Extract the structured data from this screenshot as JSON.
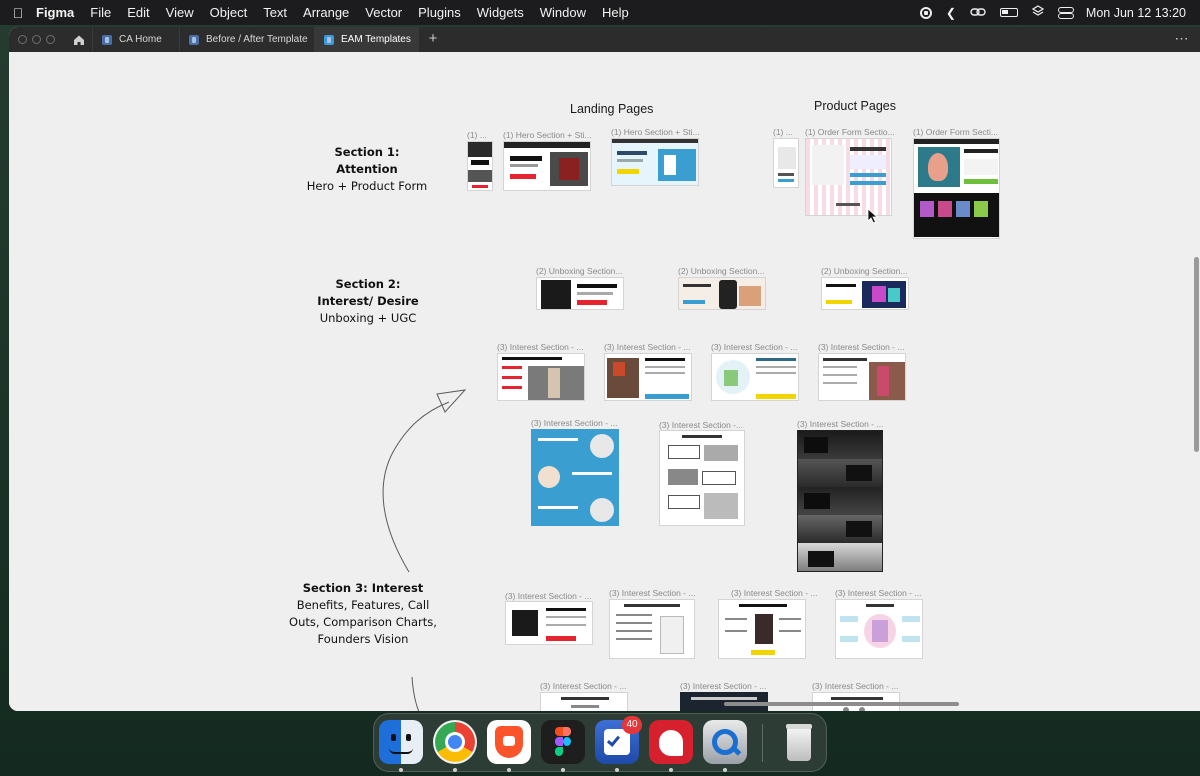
{
  "menubar": {
    "app_name": "Figma",
    "items": [
      "File",
      "Edit",
      "View",
      "Object",
      "Text",
      "Arrange",
      "Vector",
      "Plugins",
      "Widgets",
      "Window",
      "Help"
    ],
    "datetime": "Mon Jun 12  13:20"
  },
  "tabs": [
    {
      "label": "CA Home"
    },
    {
      "label": "Before / After Template"
    },
    {
      "label": "EAM Templates"
    }
  ],
  "canvas": {
    "columns": {
      "landing": "Landing Pages",
      "product": "Product Pages"
    },
    "sections": {
      "s1_title": "Section 1: Attention",
      "s1_sub": "Hero + Product Form",
      "s2_title": "Section 2: Interest/ Desire",
      "s2_sub": "Unboxing + UGC",
      "s3_title": "Section 3: Interest",
      "s3_sub": "Benefits, Features, Call Outs, Comparison Charts, Founders Vision"
    },
    "frame_labels": {
      "one_short": "(1) ...",
      "hero_a": "(1) Hero Section + Sti...",
      "hero_b": "(1) Hero Section + Sti...",
      "order_a": "(1) Order Form Sectio...",
      "order_b": "(1) Order Form Secti...",
      "unboxing": "(2) Unboxing Section...",
      "interest": "(3) Interest Section - ...",
      "interest_short": "(3) Interest Section -..."
    }
  },
  "dock": {
    "apps": [
      "finder",
      "chrome",
      "brave",
      "figma",
      "omnifocus",
      "readdle",
      "quicktime",
      "trash"
    ],
    "badge": "40"
  },
  "colors": {
    "accent_red": "#e52430",
    "accent_blue": "#3a9fd0",
    "figma_tab": "#383838"
  }
}
